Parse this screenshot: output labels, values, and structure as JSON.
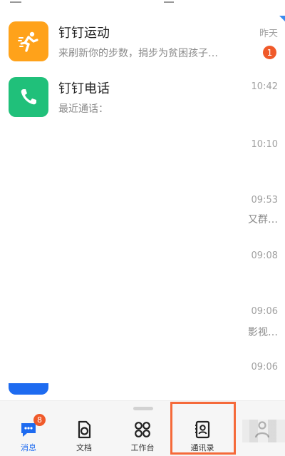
{
  "conversations": [
    {
      "name": "钉钉运动",
      "preview": "来刷新你的步数，捐步为贫困孩子…",
      "time": "昨天",
      "unread": "1",
      "icon": "running-person-icon",
      "avatar_color": "#ffa21a"
    },
    {
      "name": "钉钉电话",
      "preview": "最近通话：",
      "time": "10:42",
      "icon": "phone-icon",
      "avatar_color": "#20c07a"
    }
  ],
  "partial_rows": [
    {
      "time": "10:10",
      "preview": ""
    },
    {
      "time": "09:53",
      "preview": "又群…"
    },
    {
      "time": "09:08",
      "preview": ""
    },
    {
      "time": "09:06",
      "preview": "影视…"
    },
    {
      "time": "09:06",
      "preview": ""
    }
  ],
  "tabbar": {
    "tabs": [
      {
        "label": "消息",
        "icon": "chat-bubble-icon",
        "badge": "8",
        "active": true
      },
      {
        "label": "文档",
        "icon": "document-icon"
      },
      {
        "label": "工作台",
        "icon": "grid-apps-icon"
      },
      {
        "label": "通讯录",
        "icon": "contacts-book-icon",
        "highlighted": true
      },
      {
        "label": "",
        "icon": "profile-icon"
      }
    ]
  },
  "colors": {
    "accent": "#1e6bf0",
    "badge": "#f05a2a",
    "highlight": "#f56a3a"
  }
}
